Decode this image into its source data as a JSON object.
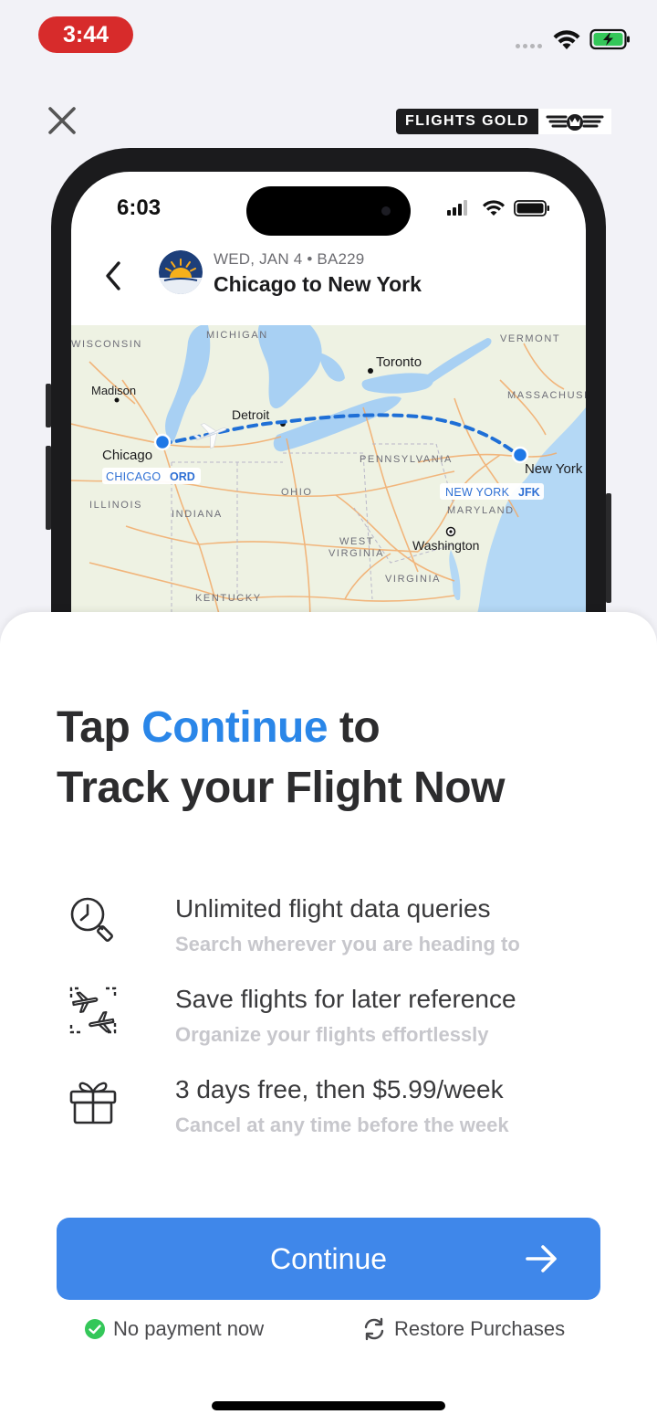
{
  "status_bar": {
    "time": "3:44"
  },
  "brand": {
    "name": "FLIGHTS GOLD"
  },
  "mockup": {
    "time": "6:03",
    "flight_meta": "WED, JAN 4 • BA229",
    "route": "Chicago to New York",
    "map": {
      "labels": {
        "michigan": "MICHIGAN",
        "wisconsin": "WISCONSIN",
        "vermont": "VERMONT",
        "massachusetts": "MASSACHUSE",
        "toronto": "Toronto",
        "madison": "Madison",
        "detroit": "Detroit",
        "chicago": "Chicago",
        "pennsylvania": "PENNSYLVANIA",
        "new_york": "New York",
        "illinois": "ILLINOIS",
        "ohio": "OHIO",
        "indiana": "INDIANA",
        "maryland": "MARYLAND",
        "washington": "Washington",
        "west_virginia_1": "WEST",
        "west_virginia_2": "VIRGINIA",
        "virginia": "VIRGINIA",
        "kentucky": "KENTUCKY"
      },
      "origin": {
        "city": "CHICAGO",
        "code": "ORD"
      },
      "destination": {
        "city": "NEW YORK",
        "code": "JFK"
      }
    }
  },
  "headline": {
    "part1": "Tap ",
    "accent": "Continue",
    "part2": " to",
    "line2": "Track your Flight Now"
  },
  "features": [
    {
      "icon": "clock-search-icon",
      "title": "Unlimited flight data queries",
      "subtitle": "Search wherever you are heading to"
    },
    {
      "icon": "planes-save-icon",
      "title": "Save flights for later reference",
      "subtitle": "Organize your flights effortlessly"
    },
    {
      "icon": "gift-icon",
      "title": "3 days free, then $5.99/week",
      "subtitle": "Cancel at any time before the week"
    }
  ],
  "cta": {
    "label": "Continue"
  },
  "footer": {
    "no_payment": "No payment now",
    "restore": "Restore Purchases"
  },
  "colors": {
    "accent": "#2a86e8",
    "button": "#3f87ea",
    "status_pill": "#d72b2b",
    "check": "#34c759"
  }
}
